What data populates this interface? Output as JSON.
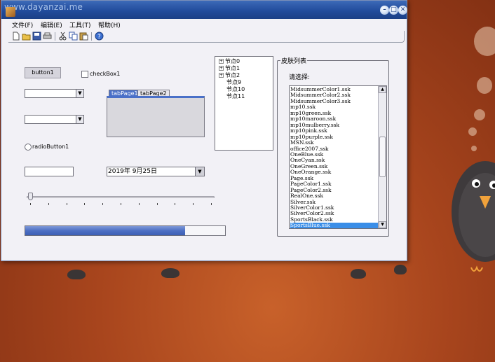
{
  "window": {
    "watermark": "www.dayanzai.me",
    "controls": {
      "minimize": "–",
      "maximize": "□",
      "close": "✕"
    }
  },
  "menu": [
    {
      "label": "文件(F)"
    },
    {
      "label": "编辑(E)"
    },
    {
      "label": "工具(T)"
    },
    {
      "label": "帮助(H)"
    }
  ],
  "toolbar": {
    "icons": [
      "new-file-icon",
      "open-folder-icon",
      "save-icon",
      "print-icon",
      "cut-icon",
      "copy-icon",
      "paste-icon",
      "help-icon"
    ]
  },
  "controls": {
    "button1": "button1",
    "checkbox1": "checkBox1",
    "radio1": "radioButton1",
    "tab1": "tabPage1",
    "tab2": "tabPage2",
    "date": "2019年  9月25日",
    "trackbar_value": 0,
    "progress_value": 0.8
  },
  "tree": {
    "nodes": [
      {
        "label": "节点0",
        "expandable": true
      },
      {
        "label": "节点1",
        "expandable": true
      },
      {
        "label": "节点2",
        "expandable": true
      },
      {
        "label": "节点9",
        "expandable": false
      },
      {
        "label": "节点10",
        "expandable": false
      },
      {
        "label": "节点11",
        "expandable": false
      }
    ]
  },
  "skins": {
    "group_title": "皮肤列表",
    "prompt": "请选择:",
    "items": [
      "MidsummerColor1.ssk",
      "MidsummerColor2.ssk",
      "MidsummerColor3.ssk",
      "mp10.ssk",
      "mp10green.ssk",
      "mp10maroon.ssk",
      "mp10mulberry.ssk",
      "mp10pink.ssk",
      "mp10purple.ssk",
      "MSN.ssk",
      "office2007.ssk",
      "OneBlue.ssk",
      "OneCyan.ssk",
      "OneGreen.ssk",
      "OneOrange.ssk",
      "Page.ssk",
      "PageColor1.ssk",
      "PageColor2.ssk",
      "RealOne.ssk",
      "Silver.ssk",
      "SilverColor1.ssk",
      "SilverColor2.ssk",
      "SportsBlack.ssk",
      "SportsBlue.ssk"
    ],
    "selected_index": 23
  },
  "colors": {
    "titlebar": "#224c9c",
    "selection": "#3a8ee8",
    "progress": "#4d6fc3",
    "tab_active": "#4a70c8"
  }
}
